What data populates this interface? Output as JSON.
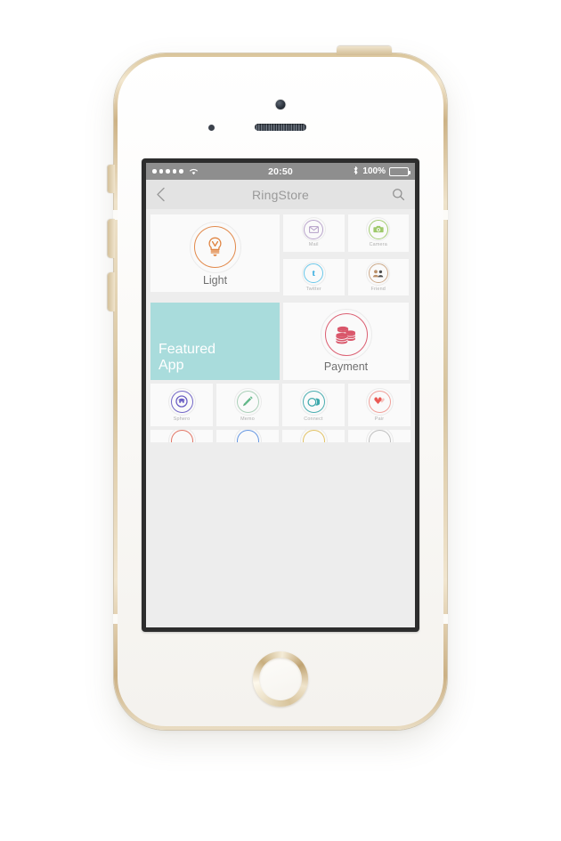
{
  "device": {
    "name": "iPhone 5s Gold",
    "camera_icon": "front-camera",
    "sensor_icon": "proximity-sensor",
    "speaker_icon": "earpiece-speaker",
    "home_button_icon": "home-button",
    "buttons": [
      "mute-switch",
      "volume-down",
      "volume-up",
      "power-button"
    ]
  },
  "status_bar": {
    "signal_dots": 5,
    "wifi_icon": "wifi-icon",
    "time": "20:50",
    "bluetooth_icon": "bluetooth-icon",
    "battery_percent": "100%",
    "battery_icon": "battery-full-icon",
    "bg_color": "#8e8e8e"
  },
  "nav_bar": {
    "back_icon": "chevron-left-icon",
    "title": "RingStore",
    "search_icon": "search-icon",
    "bg_color": "#e3e3e3",
    "title_color": "#9a9a9a"
  },
  "grid": {
    "bg_color": "#ededed",
    "tile_bg": "#fafafa",
    "featured_color": "#a9dcdc",
    "light": {
      "label": "Light",
      "icon": "lightbulb-icon",
      "color": "#e08442"
    },
    "small_apps": [
      {
        "label": "Mail",
        "icon": "envelope-icon",
        "color": "#b49ec8"
      },
      {
        "label": "Camera",
        "icon": "camera-icon",
        "color": "#9ec96a"
      },
      {
        "label": "Twitter",
        "icon": "twitter-bird-icon",
        "color": "#62c4e8"
      },
      {
        "label": "Friend",
        "icon": "people-icon",
        "color": "#c9a483"
      }
    ],
    "featured": {
      "line1": "Featured",
      "line2": "App",
      "text_color": "#ffffff"
    },
    "payment": {
      "label": "Payment",
      "icon": "coins-stack-icon",
      "color": "#d9566a"
    },
    "bottom_apps": [
      {
        "label": "Sphero",
        "icon": "sphero-robot-icon",
        "color": "#6b5fc4"
      },
      {
        "label": "Memo",
        "icon": "pencil-icon",
        "color": "#63b98a"
      },
      {
        "label": "Connect",
        "icon": "overlapping-circles-icon",
        "color": "#3fa9ac"
      },
      {
        "label": "Pair",
        "icon": "double-heart-icon",
        "color": "#ea5a55"
      }
    ],
    "clipped_row": [
      {
        "icon": "circle-outline-icon",
        "color": "#e0705f"
      },
      {
        "icon": "circle-outline-icon",
        "color": "#5f92e0"
      },
      {
        "icon": "circle-outline-icon",
        "color": "#e0c05f"
      },
      {
        "icon": "circle-outline-icon",
        "color": "#bdbdbd"
      }
    ]
  }
}
